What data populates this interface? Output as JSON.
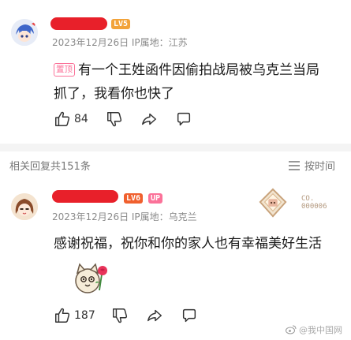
{
  "comment1": {
    "level": "LV5",
    "date_location": "2023年12月26日 IP属地：江苏",
    "pin_label": "置顶",
    "text": "有一个王姓函件因偷拍战局被乌克兰当局抓了，我看你也快了",
    "likes": "84"
  },
  "replies_header": {
    "count_label": "相关回复共151条",
    "sort_label": "按时间"
  },
  "comment2": {
    "level": "LV6",
    "up_label": "UP",
    "date_location": "2023年12月26日 IP属地：乌克兰",
    "badge_text": "CO.",
    "badge_number": "000006",
    "text": "感谢祝福，祝你和你的家人也有幸福美好生活",
    "likes": "187"
  },
  "watermark": "@我中国网"
}
